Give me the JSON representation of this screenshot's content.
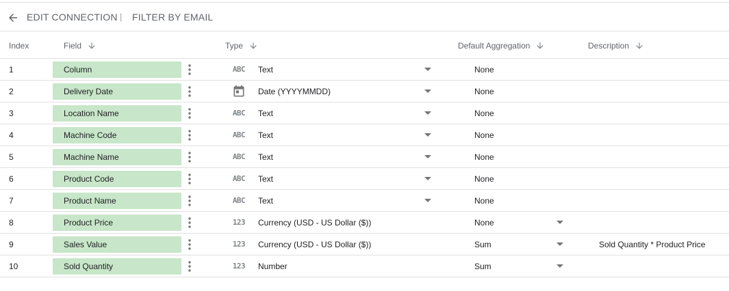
{
  "header": {
    "back_icon": "arrow-left-icon",
    "edit_connection": "EDIT CONNECTION",
    "separator": "|",
    "filter_by_email": "FILTER BY EMAIL"
  },
  "columns": {
    "index": "Index",
    "field": "Field",
    "type": "Type",
    "default_aggregation": "Default Aggregation",
    "description": "Description"
  },
  "type_icons": {
    "text": "ABC",
    "number": "123",
    "date": "calendar-icon"
  },
  "rows": [
    {
      "index": "1",
      "field": "Column",
      "type_icon": "text",
      "type": "Text",
      "aggregation": "None",
      "agg_dropdown": false,
      "description": ""
    },
    {
      "index": "2",
      "field": "Delivery Date",
      "type_icon": "date",
      "type": "Date (YYYYMMDD)",
      "aggregation": "None",
      "agg_dropdown": false,
      "description": ""
    },
    {
      "index": "3",
      "field": "Location Name",
      "type_icon": "text",
      "type": "Text",
      "aggregation": "None",
      "agg_dropdown": false,
      "description": ""
    },
    {
      "index": "4",
      "field": "Machine Code",
      "type_icon": "text",
      "type": "Text",
      "aggregation": "None",
      "agg_dropdown": false,
      "description": ""
    },
    {
      "index": "5",
      "field": "Machine Name",
      "type_icon": "text",
      "type": "Text",
      "aggregation": "None",
      "agg_dropdown": false,
      "description": ""
    },
    {
      "index": "6",
      "field": "Product Code",
      "type_icon": "text",
      "type": "Text",
      "aggregation": "None",
      "agg_dropdown": false,
      "description": ""
    },
    {
      "index": "7",
      "field": "Product Name",
      "type_icon": "text",
      "type": "Text",
      "aggregation": "None",
      "agg_dropdown": false,
      "description": ""
    },
    {
      "index": "8",
      "field": "Product Price",
      "type_icon": "number",
      "type": "Currency (USD - US Dollar ($))",
      "aggregation": "None",
      "agg_dropdown": true,
      "description": ""
    },
    {
      "index": "9",
      "field": "Sales Value",
      "type_icon": "number",
      "type": "Currency (USD - US Dollar ($))",
      "aggregation": "Sum",
      "agg_dropdown": true,
      "description": "Sold Quantity * Product Price"
    },
    {
      "index": "10",
      "field": "Sold Quantity",
      "type_icon": "number",
      "type": "Number",
      "aggregation": "Sum",
      "agg_dropdown": true,
      "description": ""
    }
  ],
  "colors": {
    "field_chip": "#c8e6c9",
    "divider": "#e0e0e0",
    "muted_text": "#5f6368"
  }
}
